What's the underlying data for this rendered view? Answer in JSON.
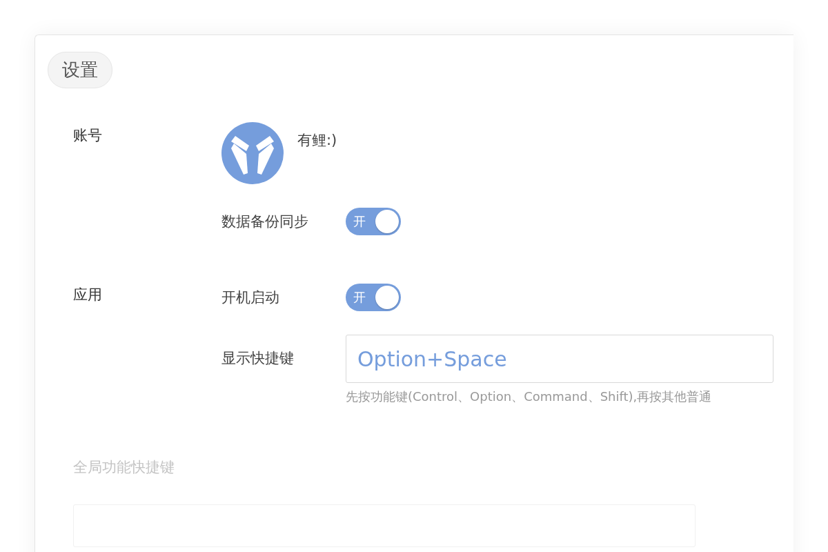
{
  "window": {
    "title": "设置"
  },
  "sections": [
    {
      "label": "账号",
      "rows": [
        {
          "kind": "profile",
          "label": "有鲤:)"
        },
        {
          "kind": "toggle",
          "label": "数据备份同步",
          "toggle_text": "开",
          "on": true
        }
      ]
    },
    {
      "label": "应用",
      "rows": [
        {
          "kind": "toggle",
          "label": "开机启动",
          "toggle_text": "开",
          "on": true
        },
        {
          "kind": "shortcut",
          "label": "显示快捷键",
          "value": "Option+Space",
          "hint": "先按功能键(Control、Option、Command、Shift),再按其他普通"
        }
      ]
    }
  ],
  "global_shortcuts": {
    "title": "全局功能快捷键"
  }
}
